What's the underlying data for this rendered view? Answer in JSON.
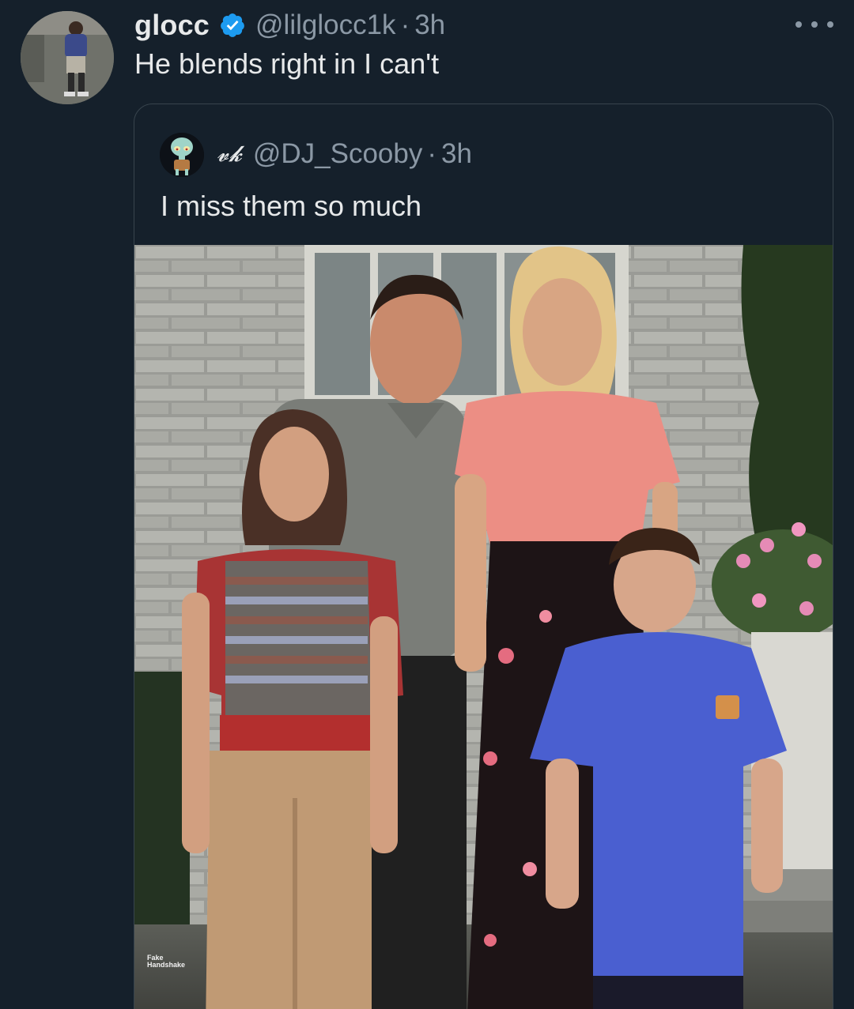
{
  "tweet": {
    "display_name": "glocc",
    "handle": "@lilglocc1k",
    "separator": "·",
    "timestamp": "3h",
    "text": "He blends right in I can't",
    "avatar_icon": "user-avatar",
    "verified_icon": "verified-badge-icon",
    "more_icon": "more-options-icon"
  },
  "quote": {
    "display_name": "𝓿𝓴",
    "handle": "@DJ_Scooby",
    "separator": "·",
    "timestamp": "3h",
    "text": "I miss them so much",
    "avatar_icon": "squidward-avatar",
    "image_watermark": "Fake Handshake"
  },
  "colors": {
    "background": "#15202b",
    "primary_text": "#e7e9ea",
    "secondary_text": "#8b98a5",
    "verified_blue": "#1d9bf0",
    "card_border": "#38444d"
  }
}
